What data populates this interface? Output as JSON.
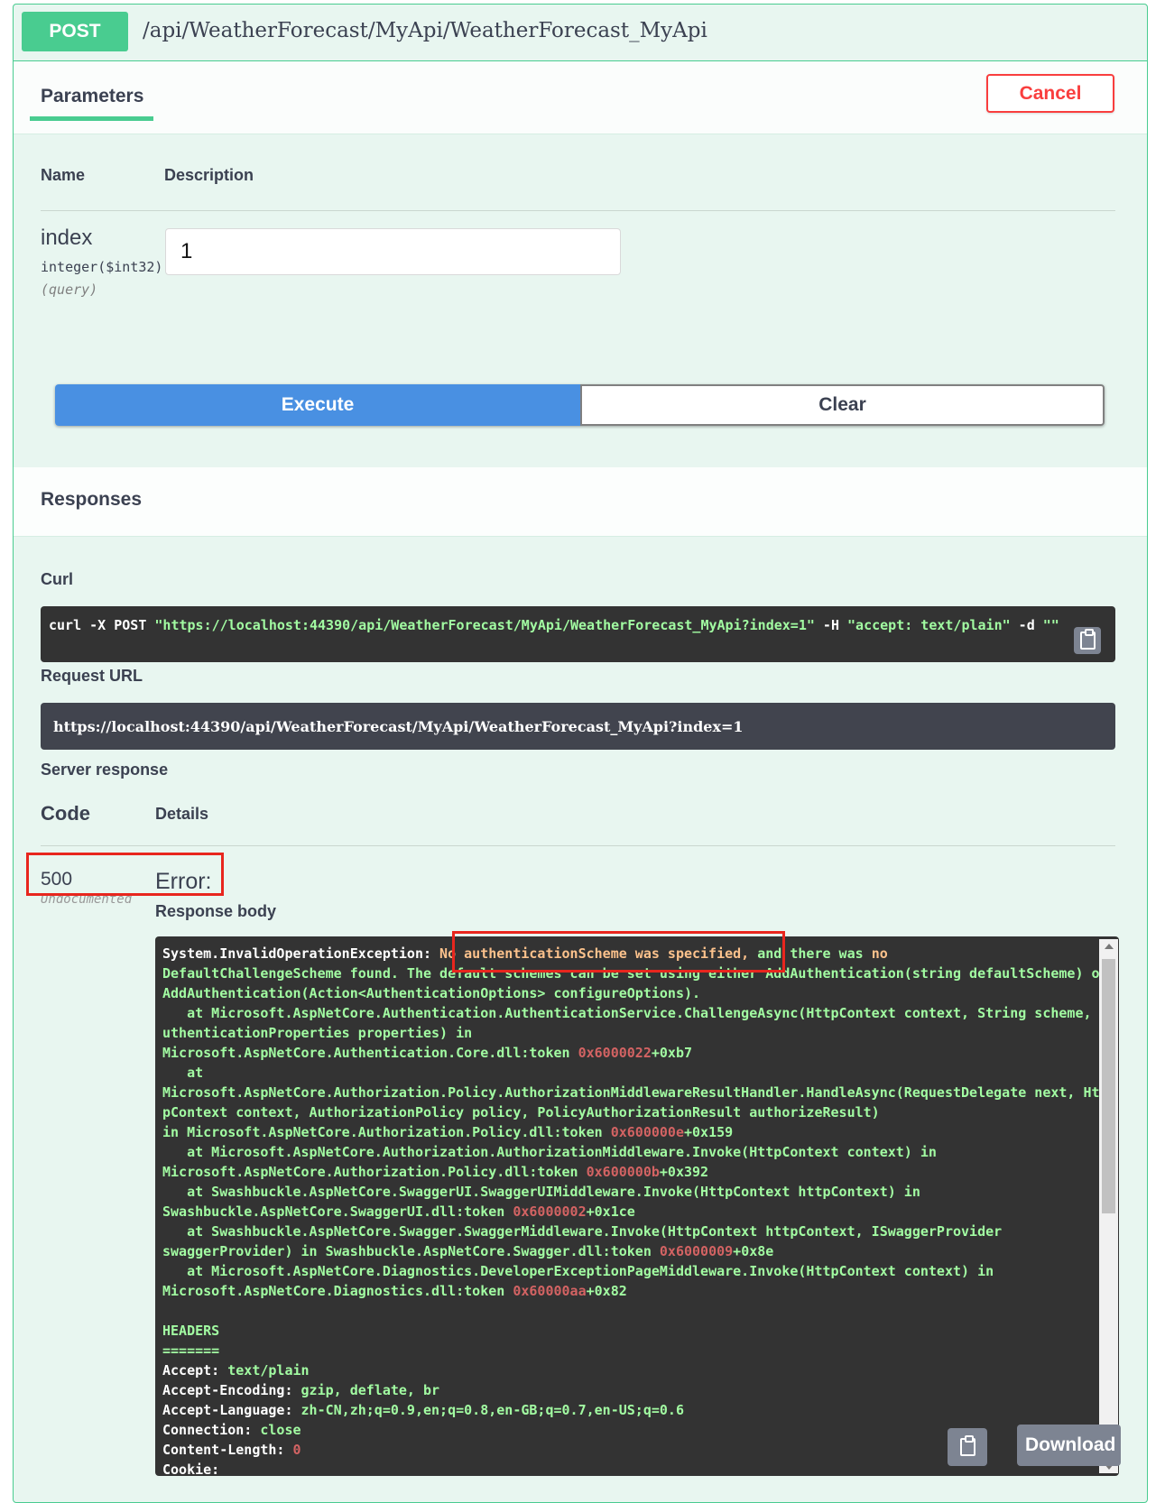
{
  "operation": {
    "method": "POST",
    "path": "/api/WeatherForecast/MyApi/WeatherForecast_MyApi",
    "method_color": "#49cc90"
  },
  "tabs": {
    "parameters_label": "Parameters",
    "cancel_label": "Cancel"
  },
  "params_table": {
    "name_header": "Name",
    "description_header": "Description",
    "rows": [
      {
        "name": "index",
        "type": "integer",
        "format": "($int32)",
        "in": "(query)",
        "value": "1"
      }
    ]
  },
  "actions": {
    "execute_label": "Execute",
    "clear_label": "Clear"
  },
  "responses": {
    "title": "Responses",
    "curl_label": "Curl",
    "curl_parts": [
      "curl -X POST ",
      "\"https://localhost:44390/api/WeatherForecast/MyApi/WeatherForecast_MyApi?index=1\"",
      " -H  ",
      "\"accept: text/plain\"",
      " -d ",
      "\"\""
    ],
    "request_url_label": "Request URL",
    "request_url": "https://localhost:44390/api/WeatherForecast/MyApi/WeatherForecast_MyApi?index=1",
    "server_response_label": "Server response",
    "code_header": "Code",
    "details_header": "Details",
    "code": "500",
    "code_note": "Undocumented",
    "error_label": "Error:",
    "response_body_label": "Response body",
    "download_label": "Download"
  },
  "response_body": [
    [
      [
        "w",
        "System.InvalidOperationException: "
      ],
      [
        "o",
        "No authenticationScheme was specified,"
      ],
      [
        "g",
        " and there was "
      ],
      [
        "o",
        "no"
      ]
    ],
    [
      [
        "g",
        "DefaultChallengeScheme found. The default schemes can be set using either AddAuthentication(string defaultScheme) or AddAuthentication(Action<AuthenticationOptions> configureOptions).\n   at Microsoft.AspNetCore.Authentication.AuthenticationService.ChallengeAsync(HttpContext context, String scheme, AuthenticationProperties properties) in\nMicrosoft.AspNetCore.Authentication.Core.dll:token "
      ],
      [
        "r",
        "0x6000022"
      ],
      [
        "g",
        "+0xb7\n   at\nMicrosoft.AspNetCore.Authorization.Policy.AuthorizationMiddlewareResultHandler.HandleAsync(RequestDelegate next, HttpContext context, AuthorizationPolicy policy, PolicyAuthorizationResult authorizeResult)\nin Microsoft.AspNetCore.Authorization.Policy.dll:token "
      ],
      [
        "r",
        "0x600000e"
      ],
      [
        "g",
        "+0x159\n   at Microsoft.AspNetCore.Authorization.AuthorizationMiddleware.Invoke(HttpContext context) in\nMicrosoft.AspNetCore.Authorization.Policy.dll:token "
      ],
      [
        "r",
        "0x600000b"
      ],
      [
        "g",
        "+0x392\n   at Swashbuckle.AspNetCore.SwaggerUI.SwaggerUIMiddleware.Invoke(HttpContext httpContext) in\nSwashbuckle.AspNetCore.SwaggerUI.dll:token "
      ],
      [
        "r",
        "0x6000002"
      ],
      [
        "g",
        "+0x1ce\n   at Swashbuckle.AspNetCore.Swagger.SwaggerMiddleware.Invoke(HttpContext httpContext, ISwaggerProvider\nswaggerProvider) in Swashbuckle.AspNetCore.Swagger.dll:token "
      ],
      [
        "r",
        "0x6000009"
      ],
      [
        "g",
        "+0x8e\n   at Microsoft.AspNetCore.Diagnostics.DeveloperExceptionPageMiddleware.Invoke(HttpContext context) in\nMicrosoft.AspNetCore.Diagnostics.dll:token "
      ],
      [
        "r",
        "0x60000aa"
      ],
      [
        "g",
        "+0x82\n\nHEADERS\n=======\n"
      ],
      [
        "w",
        "Accept: "
      ],
      [
        "g",
        "text/plain\n"
      ],
      [
        "w",
        "Accept-Encoding: "
      ],
      [
        "g",
        "gzip, deflate, br\n"
      ],
      [
        "w",
        "Accept-Language: "
      ],
      [
        "g",
        "zh-CN,zh;q=0.9,en;q=0.8,en-GB;q=0.7,en-US;q=0.6\n"
      ],
      [
        "w",
        "Connection: "
      ],
      [
        "g",
        "close\n"
      ],
      [
        "w",
        "Content-Length: "
      ],
      [
        "r",
        "0"
      ],
      [
        "g",
        "\n"
      ],
      [
        "w",
        "Cookie:"
      ]
    ]
  ]
}
